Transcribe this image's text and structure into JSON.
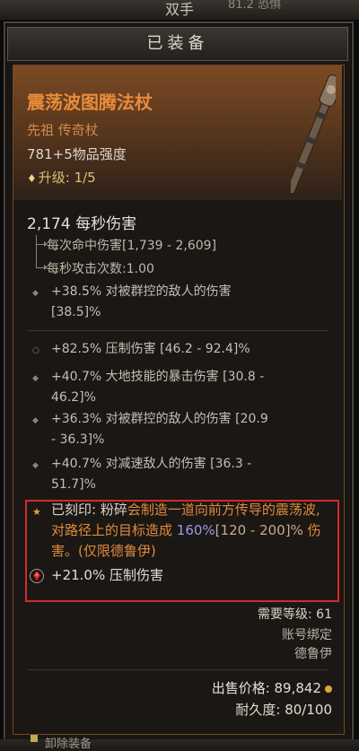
{
  "top_bar": {
    "label": "双手",
    "right_text": "81.2 恐惧"
  },
  "header": {
    "title": "已装备"
  },
  "item": {
    "name": "震荡波图腾法杖",
    "rarity": "先祖 传奇杖",
    "power": "781+5物品强度",
    "upgrade": "升级: 1/5",
    "dps": "2,174 每秒伤害",
    "damage_per_hit": "每次命中伤害[1,739 - 2,609]",
    "attack_speed": "每秒攻击次数:1.00",
    "implicit": [
      "+38.5% 对被群控的敌人的伤害",
      "[38.5]%"
    ],
    "affixes": [
      {
        "line1": "+82.5% 压制伤害 [46.2 - 92.4]%",
        "line2": ""
      },
      {
        "line1": "+40.7% 大地技能的暴击伤害 [30.8 -",
        "line2": "46.2]%"
      },
      {
        "line1": "+36.3% 对被群控的敌人的伤害 [20.9",
        "line2": "- 36.3]%"
      },
      {
        "line1": "+40.7% 对减速敌人的伤害 [36.3 -",
        "line2": "51.7]%"
      }
    ],
    "aspect": {
      "label": "已刻印: ",
      "keyword": "粉碎",
      "text1": "会制造一道向前方传导的",
      "text2": "震荡波, 对路径上的目标造成 ",
      "value": "160%",
      "range": "[120 - 200]% ",
      "text3": "伤害。(仅限德鲁伊)"
    },
    "gem_bonus": "+21.0% 压制伤害",
    "requirements": {
      "level": "需要等级: 61",
      "bound": "账号绑定",
      "class": "德鲁伊"
    },
    "sell_price": "出售价格: 89,842",
    "durability": "耐久度: 80/100"
  },
  "footer": {
    "action": "卸除装备"
  },
  "colors": {
    "legendary": "#e98b3c",
    "highlight_box": "#d42a2a",
    "value": "#9a9ae8"
  }
}
